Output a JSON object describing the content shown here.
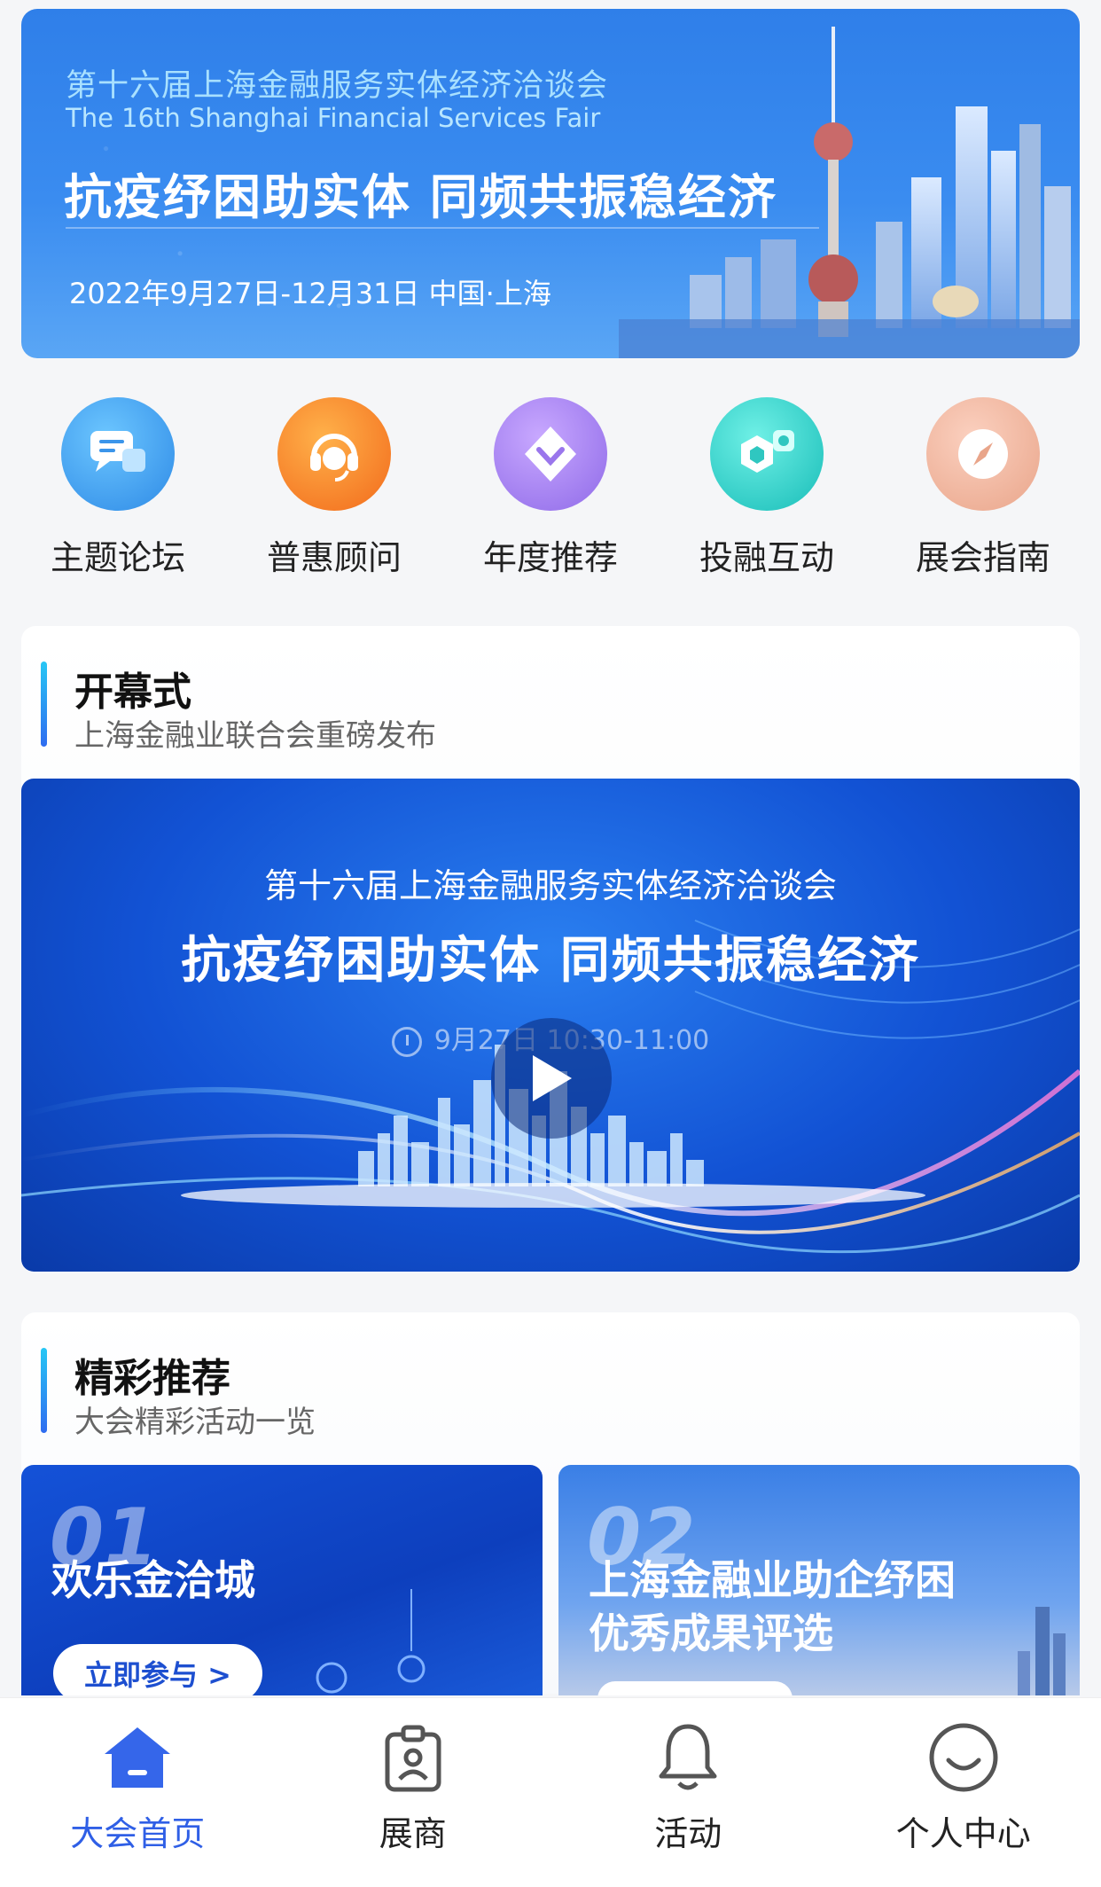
{
  "hero": {
    "title_cn": "第十六届上海金融服务实体经济洽谈会",
    "title_en": "The 16th Shanghai Financial Services Fair",
    "slogan": "抗疫纾困助实体 同频共振稳经济",
    "date_location": "2022年9月27日-12月31日  中国·上海"
  },
  "quick_nav": [
    {
      "label": "主题论坛",
      "icon": "chat-bubble-icon",
      "color": "#2e8ae6"
    },
    {
      "label": "普惠顾问",
      "icon": "headset-icon",
      "color": "#f26a1b"
    },
    {
      "label": "年度推荐",
      "icon": "diamond-icon",
      "color": "#8f6ae8"
    },
    {
      "label": "投融互动",
      "icon": "exchange-icon",
      "color": "#18bdb8"
    },
    {
      "label": "展会指南",
      "icon": "compass-icon",
      "color": "#e9a58a"
    }
  ],
  "opening": {
    "title": "开幕式",
    "subtitle": "上海金融业联合会重磅发布",
    "video": {
      "title": "第十六届上海金融服务实体经济洽谈会",
      "slogan": "抗疫纾困助实体 同频共振稳经济",
      "time": "9月27日  10:30-11:00"
    }
  },
  "recommend": {
    "title": "精彩推荐",
    "subtitle": "大会精彩活动一览",
    "cards": [
      {
        "num": "01",
        "title": "欢乐金洽城",
        "button": "立即参与 >"
      },
      {
        "num": "02",
        "title_line1": "上海金融业助企纾困",
        "title_line2": "优秀成果评选"
      }
    ]
  },
  "tabbar": [
    {
      "label": "大会首页",
      "icon": "home-icon",
      "active": true
    },
    {
      "label": "展商",
      "icon": "badge-icon",
      "active": false
    },
    {
      "label": "活动",
      "icon": "bell-icon",
      "active": false
    },
    {
      "label": "个人中心",
      "icon": "smile-icon",
      "active": false
    }
  ],
  "colors": {
    "accent": "#2f5fe6",
    "background": "#f5f6f8"
  }
}
